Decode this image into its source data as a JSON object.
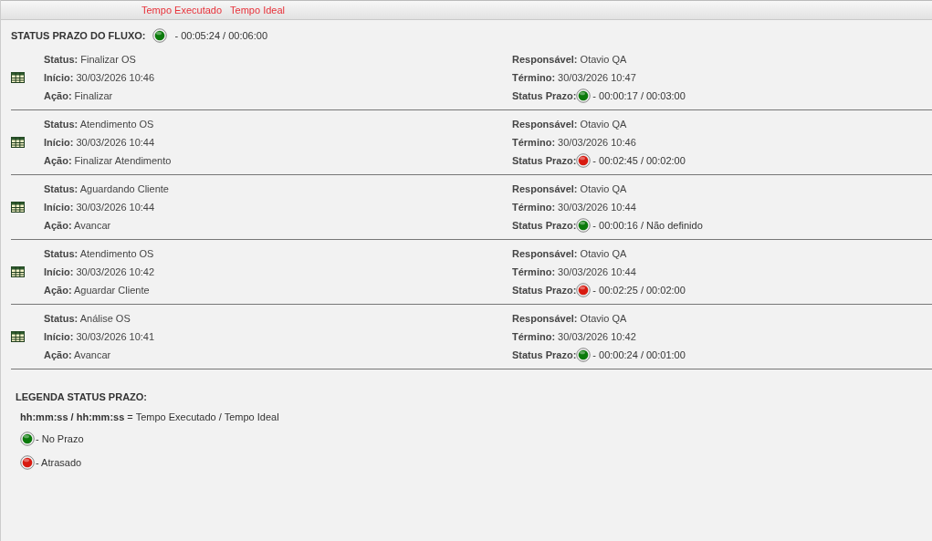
{
  "top_bar": {
    "labels": [
      "Tempo Executado",
      "Tempo Ideal"
    ]
  },
  "flow_status": {
    "label": "STATUS PRAZO DO FLUXO:",
    "color": "#0b7a0b",
    "value": "- 00:05:24 / 00:06:00"
  },
  "steps": [
    {
      "status": "**Status:** Finalizar OS",
      "inicio": "**Início:** 30/03/2026 10:46",
      "acao": "**Ação:** Finalizar",
      "responsavel": "**Responsável:** Otavio QA",
      "termino": "**Término:** 30/03/2026 10:47",
      "prazo_label": "Status Prazo:",
      "color": "#0b7a0b",
      "prazo": "- 00:00:17 / 00:03:00"
    },
    {
      "status": "**Status:** Atendimento OS",
      "inicio": "**Início:** 30/03/2026 10:44",
      "acao": "**Ação:** Finalizar Atendimento",
      "responsavel": "**Responsável:** Otavio QA",
      "termino": "**Término:** 30/03/2026 10:46",
      "prazo_label": "Status Prazo:",
      "color": "#d81a10",
      "prazo": "- 00:02:45 / 00:02:00"
    },
    {
      "status": "**Status:** Aguardando Cliente",
      "inicio": "**Início:** 30/03/2026 10:44",
      "acao": "**Ação:** Avancar",
      "responsavel": "**Responsável:** Otavio QA",
      "termino": "**Término:** 30/03/2026 10:44",
      "prazo_label": "Status Prazo:",
      "color": "#0b7a0b",
      "prazo": "- 00:00:16 / Não definido"
    },
    {
      "status": "**Status:** Atendimento OS",
      "inicio": "**Início:** 30/03/2026 10:42",
      "acao": "**Ação:** Aguardar Cliente",
      "responsavel": "**Responsável:** Otavio QA",
      "termino": "**Término:** 30/03/2026 10:44",
      "prazo_label": "Status Prazo:",
      "color": "#d81a10",
      "prazo": "- 00:02:25 / 00:02:00"
    },
    {
      "status": "**Status:** Análise OS",
      "inicio": "**Início:** 30/03/2026 10:41",
      "acao": "**Ação:** Avancar",
      "responsavel": "**Responsável:** Otavio QA",
      "termino": "**Término:** 30/03/2026 10:42",
      "prazo_label": "Status Prazo:",
      "color": "#0b7a0b",
      "prazo": "- 00:00:24 / 00:01:00"
    }
  ],
  "legend": {
    "title": "LEGENDA STATUS PRAZO:",
    "format": "**hh:mm:ss / hh:mm:ss** = Tempo Executado / Tempo Ideal",
    "items": [
      {
        "color": "#0b7a0b",
        "label": "- No Prazo"
      },
      {
        "color": "#d81a10",
        "label": "- Atrasado"
      }
    ]
  }
}
